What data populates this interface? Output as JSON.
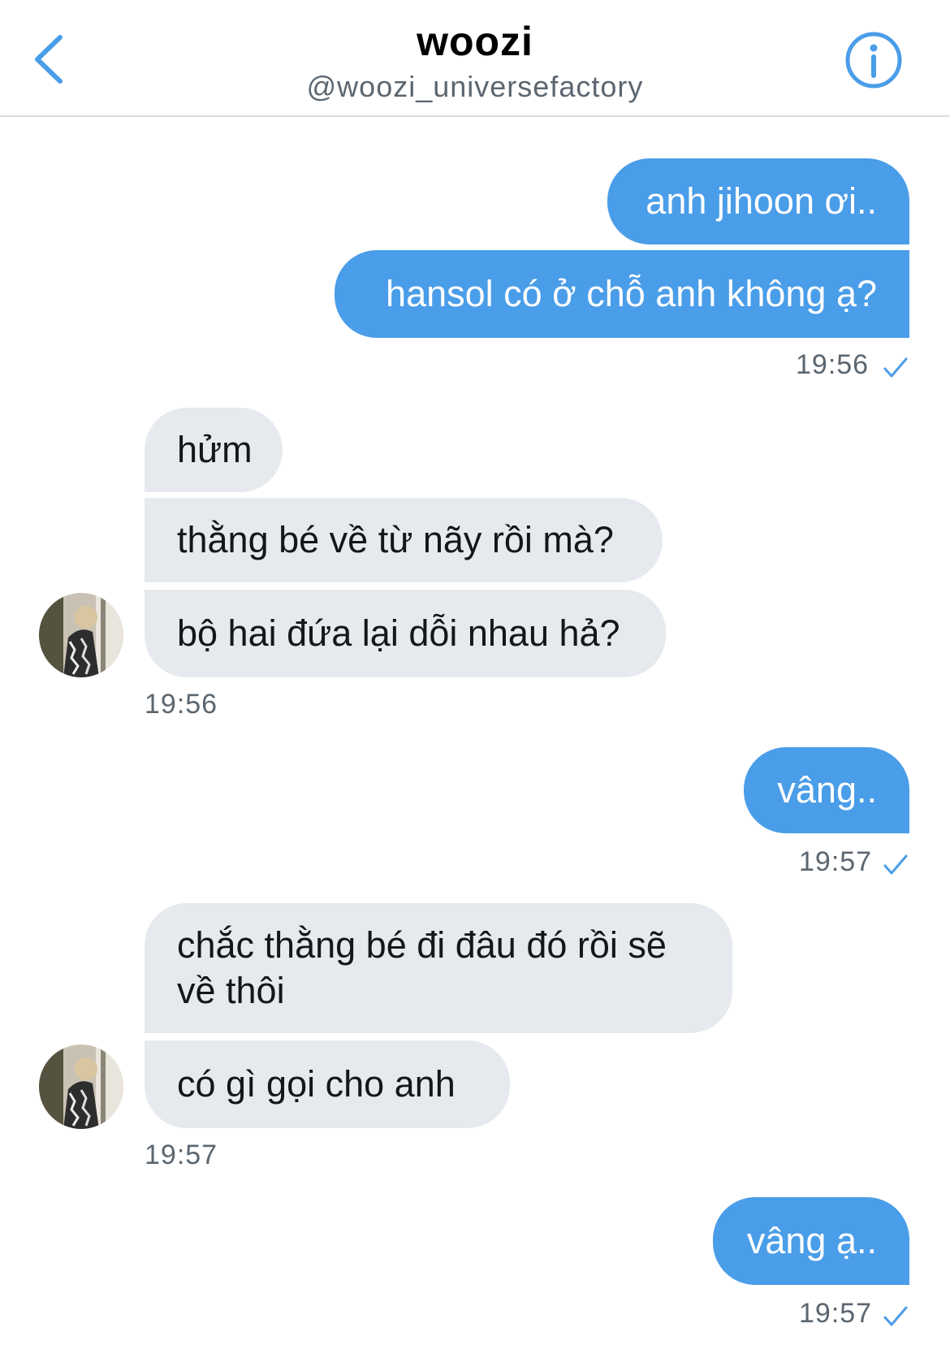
{
  "header": {
    "title": "woozi",
    "handle": "@woozi_universefactory"
  },
  "colors": {
    "accent": "#4a9de8",
    "incoming_bubble": "#e6e9ee",
    "timestamp": "#5b6670"
  },
  "icons": {
    "back": "chevron-left-icon",
    "info": "info-icon",
    "read_receipt": "checkmark-icon"
  },
  "messages": [
    {
      "direction": "outgoing",
      "text": "anh jihoon ơi.."
    },
    {
      "direction": "outgoing",
      "text": "hansol có ở chỗ anh không ạ?"
    },
    {
      "direction": "incoming",
      "text": "hửm"
    },
    {
      "direction": "incoming",
      "text": "thằng bé về từ nãy rồi mà?"
    },
    {
      "direction": "incoming",
      "text": "bộ hai đứa lại dỗi nhau hả?"
    },
    {
      "direction": "outgoing",
      "text": "vâng.."
    },
    {
      "direction": "incoming",
      "text_line1": "chắc thằng bé đi đâu đó rồi sẽ",
      "text_line2": "về thôi"
    },
    {
      "direction": "incoming",
      "text": "có gì gọi cho anh"
    },
    {
      "direction": "outgoing",
      "text": "vâng ạ.."
    }
  ],
  "timestamps": [
    "19:56",
    "19:56",
    "19:57",
    "19:57",
    "19:57"
  ]
}
